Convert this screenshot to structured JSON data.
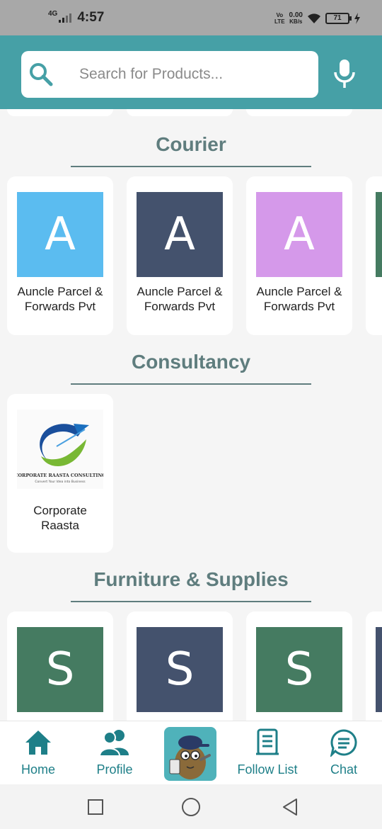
{
  "status_bar": {
    "network": "4G",
    "time": "4:57",
    "volte_top": "Vo",
    "volte_bottom": "LTE",
    "speed_value": "0.00",
    "speed_unit": "KB/s",
    "battery": "71"
  },
  "search": {
    "placeholder": "Search for Products..."
  },
  "sections": [
    {
      "title": "Courier",
      "cards": [
        {
          "letter": "A",
          "name": "Auncle Parcel & Forwards Pvt",
          "color": "#5bbcf0"
        },
        {
          "letter": "A",
          "name": "Auncle Parcel & Forwards Pvt",
          "color": "#44526d"
        },
        {
          "letter": "A",
          "name": "Auncle Parcel & Forwards Pvt",
          "color": "#d599ea"
        }
      ]
    },
    {
      "title": "Consultancy",
      "cards": [
        {
          "name": "Corporate Raasta",
          "logo_text": "CORPORATE RAASTA CONSULTING",
          "logo_tagline": "Convert Your Idea into Business"
        }
      ]
    },
    {
      "title": "Furniture & Supplies",
      "cards": [
        {
          "letter": "S",
          "color": "#457b61"
        },
        {
          "letter": "S",
          "color": "#44526d"
        },
        {
          "letter": "S",
          "color": "#457b61"
        }
      ]
    }
  ],
  "bottom_nav": {
    "items": [
      {
        "label": "Home",
        "icon": "home-icon"
      },
      {
        "label": "Profile",
        "icon": "profile-icon"
      },
      {
        "label": "Follow List",
        "icon": "follow-list-icon"
      },
      {
        "label": "Chat",
        "icon": "chat-icon"
      }
    ],
    "center_icon": "mascot-icon"
  },
  "colors": {
    "primary": "#46a0a6",
    "section_title": "#5f7d7e",
    "nav_accent": "#1e7f88"
  }
}
